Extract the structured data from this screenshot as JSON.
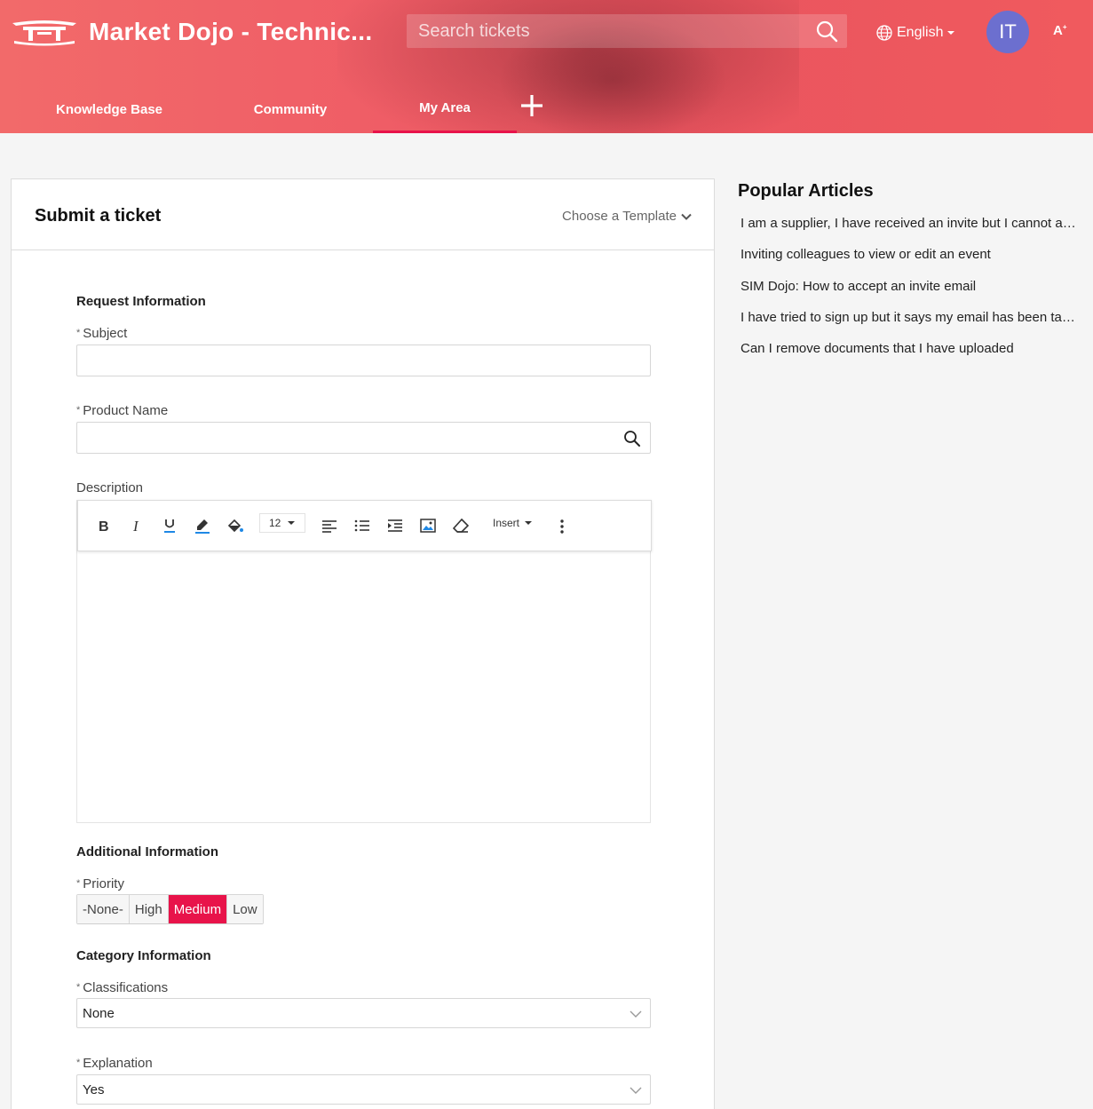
{
  "header": {
    "brand_title": "Market Dojo - Technic...",
    "search_placeholder": "Search tickets",
    "language": "English",
    "avatar_initials": "IT",
    "font_size_label": "A",
    "nav": [
      {
        "label": "Knowledge Base"
      },
      {
        "label": "Community"
      },
      {
        "label": "My Area"
      }
    ]
  },
  "ticket": {
    "title": "Submit a ticket",
    "template_label": "Choose a Template",
    "request_section": "Request Information",
    "subject_label": "Subject",
    "product_label": "Product Name",
    "description_label": "Description",
    "editor": {
      "font_size": "12",
      "insert_label": "Insert"
    },
    "additional_section": "Additional Information",
    "priority_label": "Priority",
    "priority_options": [
      "-None-",
      "High",
      "Medium",
      "Low"
    ],
    "priority_selected": "Medium",
    "category_section": "Category Information",
    "classifications_label": "Classifications",
    "classifications_value": "None",
    "explanation_label": "Explanation",
    "explanation_value": "Yes"
  },
  "sidebar": {
    "title": "Popular Articles",
    "articles": [
      "I am a supplier, I have received an invite but I cannot access the event",
      "Inviting colleagues to view or edit an event",
      "SIM Dojo: How to accept an invite email",
      "I have tried to sign up but it says my email has been taken",
      "Can I remove documents that I have uploaded"
    ]
  },
  "colors": {
    "header_gradient": "#ef5d66",
    "accent": "#e8134a",
    "avatar_bg": "#6c6fcf"
  }
}
